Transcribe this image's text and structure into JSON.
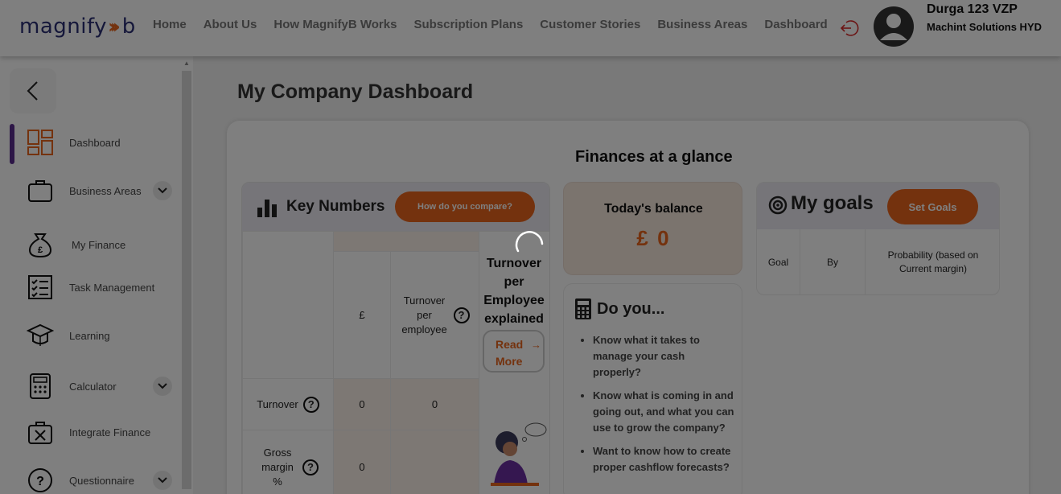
{
  "header": {
    "logo_text": "magnify",
    "logo_suffix": "b",
    "nav": [
      "Home",
      "About Us",
      "How MagnifyB Works",
      "Subscription Plans",
      "Customer Stories",
      "Business Areas",
      "Dashboard"
    ],
    "user_name": "Durga 123 VZP",
    "user_company": "Machint Solutions HYD",
    "logout_icon": "logout-icon"
  },
  "sidebar": {
    "items": [
      {
        "label": "Dashboard",
        "icon": "dashboard-icon",
        "active": true
      },
      {
        "label": "Business Areas",
        "icon": "briefcase-icon",
        "dropdown": true
      },
      {
        "label": "My Finance",
        "icon": "money-bag-icon"
      },
      {
        "label": "Task Management",
        "icon": "checklist-icon"
      },
      {
        "label": "Learning",
        "icon": "graduation-cap-icon"
      },
      {
        "label": "Calculator",
        "icon": "calculator-icon",
        "dropdown": true
      },
      {
        "label": "Integrate Finance",
        "icon": "toolbox-icon"
      },
      {
        "label": "Questionnaire",
        "icon": "question-circle-icon",
        "dropdown": true
      }
    ]
  },
  "main": {
    "page_title": "My Company Dashboard",
    "glance_title": "Finances at a glance",
    "key_numbers": {
      "title": "Key Numbers",
      "compare_label": "How do you compare?",
      "col_currency": "£",
      "col_turnover_per_employee": "Turnover per employee",
      "rows": [
        {
          "label": "Turnover",
          "value": "0",
          "per_employee": "0"
        },
        {
          "label": "Gross margin %",
          "value": "0",
          "per_employee": ""
        }
      ],
      "explainer_title": "Turnover per Employee explained",
      "read_more_label": "Read More",
      "read_more_arrow": "→"
    },
    "balance": {
      "title": "Today's balance",
      "value": "£ 0"
    },
    "do_you": {
      "title": "Do you...",
      "items": [
        "Know what it takes to manage your cash properly?",
        "Know what is coming in and going out, and what you can use to grow the company?",
        "Want to know how to create proper cashflow forecasts?"
      ]
    },
    "goals": {
      "title": "My goals",
      "set_goals_label": "Set Goals",
      "columns": [
        "Goal",
        "By",
        "Probability (based on Current margin)"
      ]
    }
  },
  "colors": {
    "accent": "#e8651c",
    "brand": "#2b2f74",
    "active_indicator": "#5b2d8e"
  }
}
